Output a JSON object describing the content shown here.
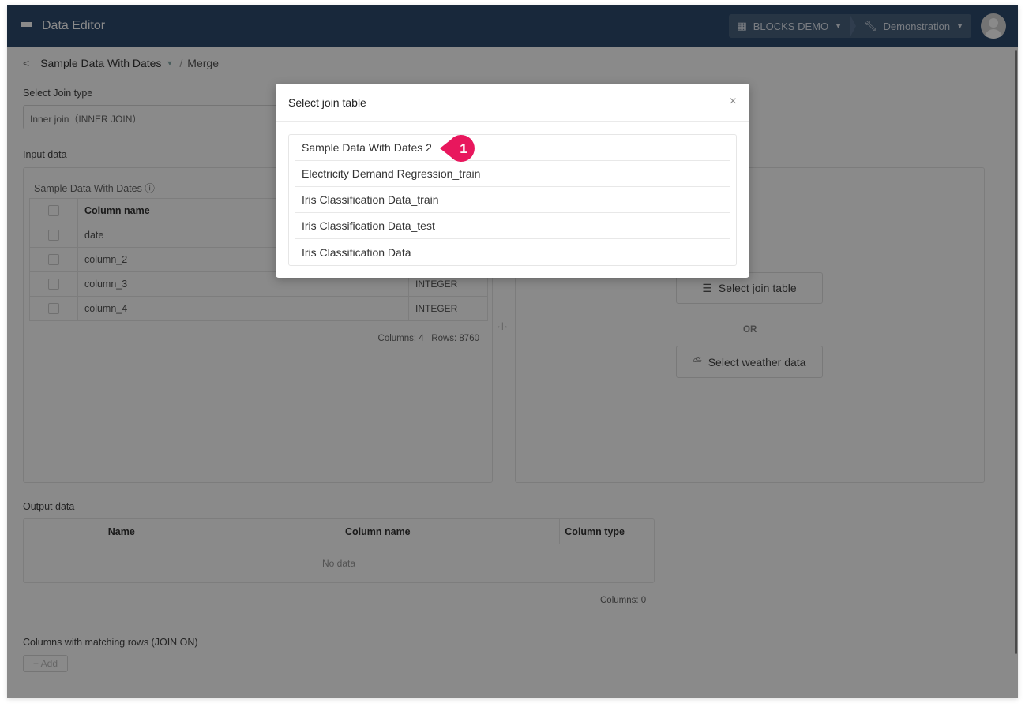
{
  "app": {
    "title": "Data Editor",
    "org_label": "BLOCKS DEMO",
    "project_label": "Demonstration"
  },
  "breadcrumb": {
    "dataset": "Sample Data With Dates",
    "separator": "/",
    "current": "Merge"
  },
  "join_type": {
    "label": "Select Join type",
    "value": "Inner join（INNER JOIN）"
  },
  "input_data": {
    "label": "Input data",
    "table_title": "Sample Data With Dates",
    "column_header": "Column name",
    "rows": [
      {
        "name": "date",
        "type": ""
      },
      {
        "name": "column_2",
        "type": ""
      },
      {
        "name": "column_3",
        "type": "INTEGER"
      },
      {
        "name": "column_4",
        "type": "INTEGER"
      }
    ],
    "counts": "Columns: 4   Rows: 8760"
  },
  "join_target": {
    "select_table_label": "Select join table",
    "or_label": "OR",
    "select_weather_label": "Select weather data"
  },
  "output_data": {
    "label": "Output data",
    "headers": [
      "",
      "Name",
      "Column name",
      "Column type"
    ],
    "empty_text": "No data",
    "counts": "Columns: 0"
  },
  "join_on": {
    "label": "Columns with matching rows (JOIN ON)",
    "add_label": "+ Add"
  },
  "modal": {
    "title": "Select join table",
    "close_icon": "×",
    "items": [
      "Sample Data With Dates 2",
      "Electricity Demand Regression_train",
      "Iris Classification Data_train",
      "Iris Classification Data_test",
      "Iris Classification Data"
    ],
    "step_marker": "1",
    "marker_color": "#e8175d"
  }
}
